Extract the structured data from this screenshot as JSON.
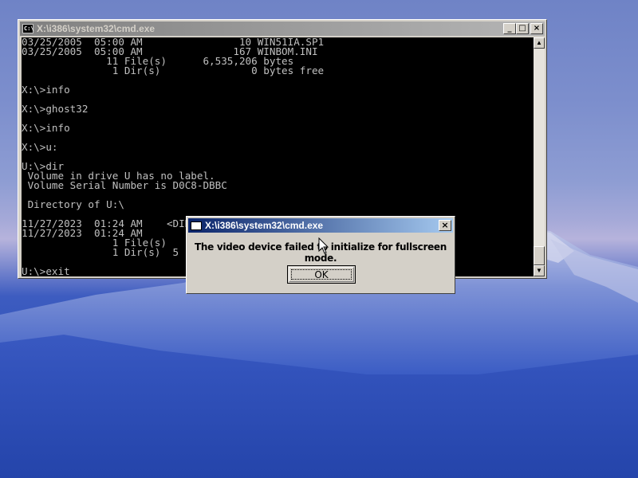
{
  "console_window": {
    "title": "X:\\i386\\system32\\cmd.exe",
    "icon": "console-app-icon",
    "icon_text": "C:\\",
    "buttons": {
      "minimize": "_",
      "maximize": "□",
      "close": "×"
    },
    "lines": [
      "03/25/2005  05:00 AM                10 WIN51IA.SP1",
      "03/25/2005  05:00 AM               167 WINBOM.INI",
      "              11 File(s)      6,535,206 bytes",
      "               1 Dir(s)               0 bytes free",
      "",
      "X:\\>info",
      "",
      "X:\\>ghost32",
      "",
      "X:\\>info",
      "",
      "X:\\>u:",
      "",
      "U:\\>dir",
      " Volume in drive U has no label.",
      " Volume Serial Number is D0C8-DBBC",
      "",
      " Directory of U:\\",
      "",
      "11/27/2023  01:24 AM    <DIR>",
      "11/27/2023  01:24 AM",
      "               1 File(s)",
      "               1 Dir(s)  5",
      "",
      "U:\\>exit"
    ],
    "scrollbar": {
      "up_glyph": "▲",
      "down_glyph": "▼"
    }
  },
  "dialog": {
    "title": "X:\\i386\\system32\\cmd.exe",
    "message": "The video device failed to initialize for fullscreen mode.",
    "ok_label": "OK",
    "close_glyph": "×"
  },
  "colors": {
    "console_bg": "#000000",
    "console_text": "#c0c0c0",
    "active_title_start": "#0a246a",
    "active_title_end": "#a6caf0",
    "inactive_title": "#808080",
    "face": "#d4d0c8"
  }
}
